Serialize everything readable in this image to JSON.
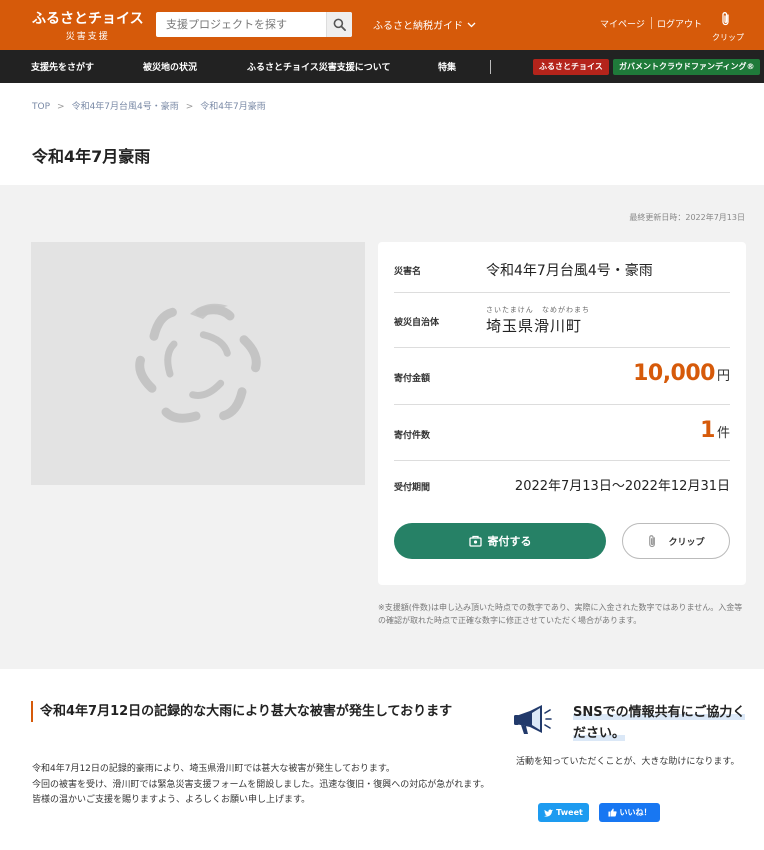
{
  "header": {
    "logo_main": "ふるさとチョイス",
    "logo_sub": "災害支援",
    "search_placeholder": "支援プロジェクトを探す",
    "guide_label": "ふるさと納税ガイド",
    "mypage_label": "マイページ",
    "logout_label": "ログアウト",
    "clip_label": "クリップ",
    "colors": {
      "brand": "#d65a0a"
    }
  },
  "nav": {
    "items": [
      "支援先をさがす",
      "被災地の状況",
      "ふるさとチョイス災害支援について",
      "特集"
    ],
    "badge_choice": "ふるさとチョイス",
    "badge_gcf": "ガバメントクラウドファンディング®",
    "colors": {
      "choice": "#b4241b",
      "gcf": "#1f7a3a"
    }
  },
  "breadcrumb": {
    "items": [
      "TOP",
      "令和4年7月台風4号・豪雨",
      "令和4年7月豪雨"
    ],
    "sep": ">"
  },
  "page": {
    "title": "令和4年7月豪雨",
    "updated": "最終更新日時：2022年7月13日"
  },
  "info": {
    "disaster_label": "災害名",
    "disaster_value": "令和4年7月台風4号・豪雨",
    "municipality_label": "被災自治体",
    "municipality_ruby_pref": "さいたまけん",
    "municipality_ruby_town": "なめがわまち",
    "municipality_value": "埼玉県滑川町",
    "amount_label": "寄付金額",
    "amount_value": "10,000",
    "amount_unit": "円",
    "count_label": "寄付件数",
    "count_value": "1",
    "count_unit": "件",
    "period_label": "受付期間",
    "period_value": "2022年7月13日〜2022年12月31日",
    "donate_label": "寄付する",
    "clip_label": "クリップ",
    "colors": {
      "donate": "#268166",
      "amount": "#d65a0a"
    }
  },
  "note": "※支援額(件数)は申し込み頂いた時点での数字であり、実際に入金された数字ではありません。入金等の確認が取れた時点で正確な数字に修正させていただく場合があります。",
  "article": {
    "title": "令和4年7月12日の記録的な大雨により甚大な被害が発生しております",
    "lines": [
      "令和4年7月12日の記録的豪雨により、埼玉県滑川町では甚大な被害が発生しております。",
      "今回の被害を受け、滑川町では緊急災害支援フォームを開設しました。迅速な復旧・復興への対応が急がれます。",
      "皆様の温かいご支援を賜りますよう、よろしくお願い申し上げます。"
    ]
  },
  "sns": {
    "title": "SNSでの情報共有にご協力ください。",
    "desc": "活動を知っていただくことが、大きな助けになります。",
    "tweet_label": "Tweet",
    "like_label": "いいね！",
    "colors": {
      "twitter": "#1d9bf0",
      "facebook": "#1877f2"
    }
  }
}
